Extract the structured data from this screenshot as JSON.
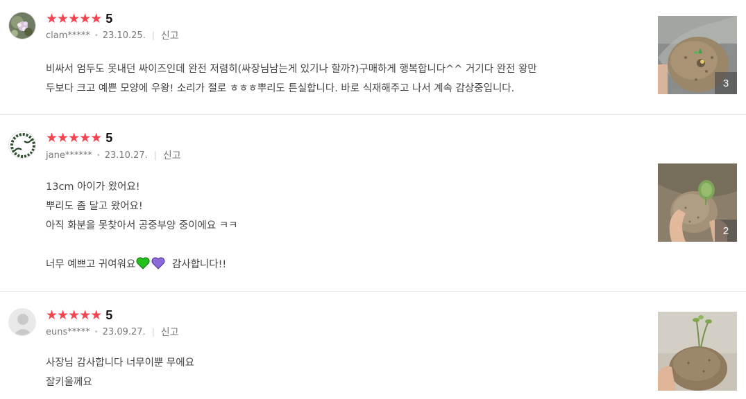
{
  "reviews": [
    {
      "avatar_icon": "flower-avatar-icon",
      "rating": 5,
      "rating_label": "5",
      "user": "clam*****",
      "date": "23.10.25.",
      "report_label": "신고",
      "lines": [
        "비싸서 엄두도 못내던 싸이즈인데 완전 저렴히(싸장님남는게 있기나 할까?)구매하게 행복합니다^^ 거기다 완전 왕만",
        "두보다 크고 예쁜 모양에 우왕! 소리가 절로 ㅎㅎㅎ뿌리도 튼실합니다. 바로 식재해주고 나서 계속 감상중입니다."
      ],
      "photo_count": "3"
    },
    {
      "avatar_icon": "wreath-logo-avatar-icon",
      "avatar_text": "re Klun",
      "rating": 5,
      "rating_label": "5",
      "user": "jane******",
      "date": "23.10.27.",
      "report_label": "신고",
      "lines": [
        "13cm 아이가 왔어요!",
        "뿌리도 좀 달고 왔어요!",
        "아직 화분을 못찾아서 공중부양 중이에요 ㅋㅋ",
        "",
        "너무 예쁘고 귀여워요",
        "감사합니다!!"
      ],
      "photo_count": "2"
    },
    {
      "avatar_icon": "default-user-avatar-icon",
      "rating": 5,
      "rating_label": "5",
      "user": "euns*****",
      "date": "23.09.27.",
      "report_label": "신고",
      "lines": [
        "사장님 감사합니다 너무이뿐 무에요",
        "잘키울께요"
      ]
    }
  ],
  "colors": {
    "star": "#f5434f",
    "green_heart": "#22c21a",
    "purple_heart": "#8c6ad8"
  }
}
